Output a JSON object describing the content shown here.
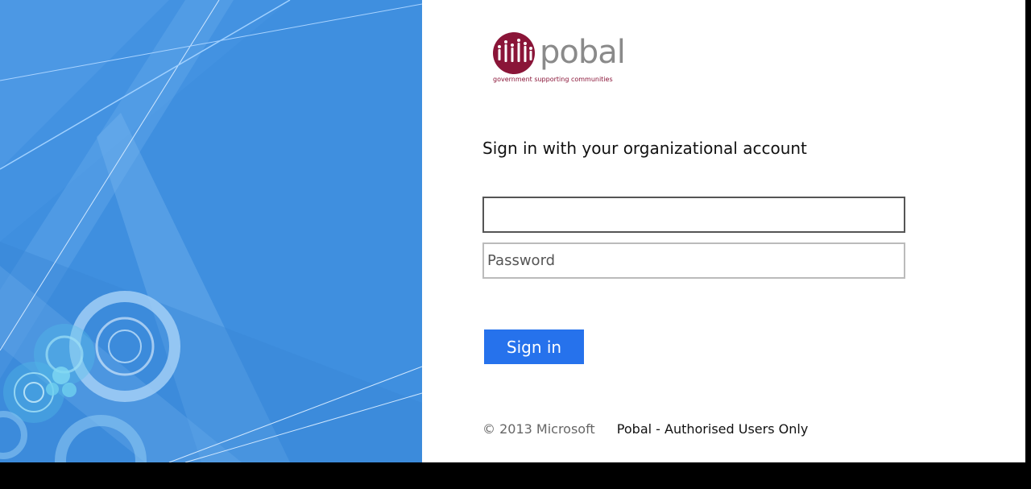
{
  "logo": {
    "brand": "pobal",
    "tagline": "government supporting communities",
    "brand_color": "#8a1538"
  },
  "signin": {
    "heading": "Sign in with your organizational account",
    "username": {
      "value": "",
      "placeholder": ""
    },
    "password": {
      "value": "",
      "placeholder": "Password"
    },
    "submit_label": "Sign in"
  },
  "footer": {
    "copyright": "© 2013 Microsoft",
    "notice": "Pobal - Authorised Users Only"
  },
  "colors": {
    "illustration_bg": "#3f8fdf",
    "button": "#2672ec",
    "panel_bg": "#ffffff"
  }
}
